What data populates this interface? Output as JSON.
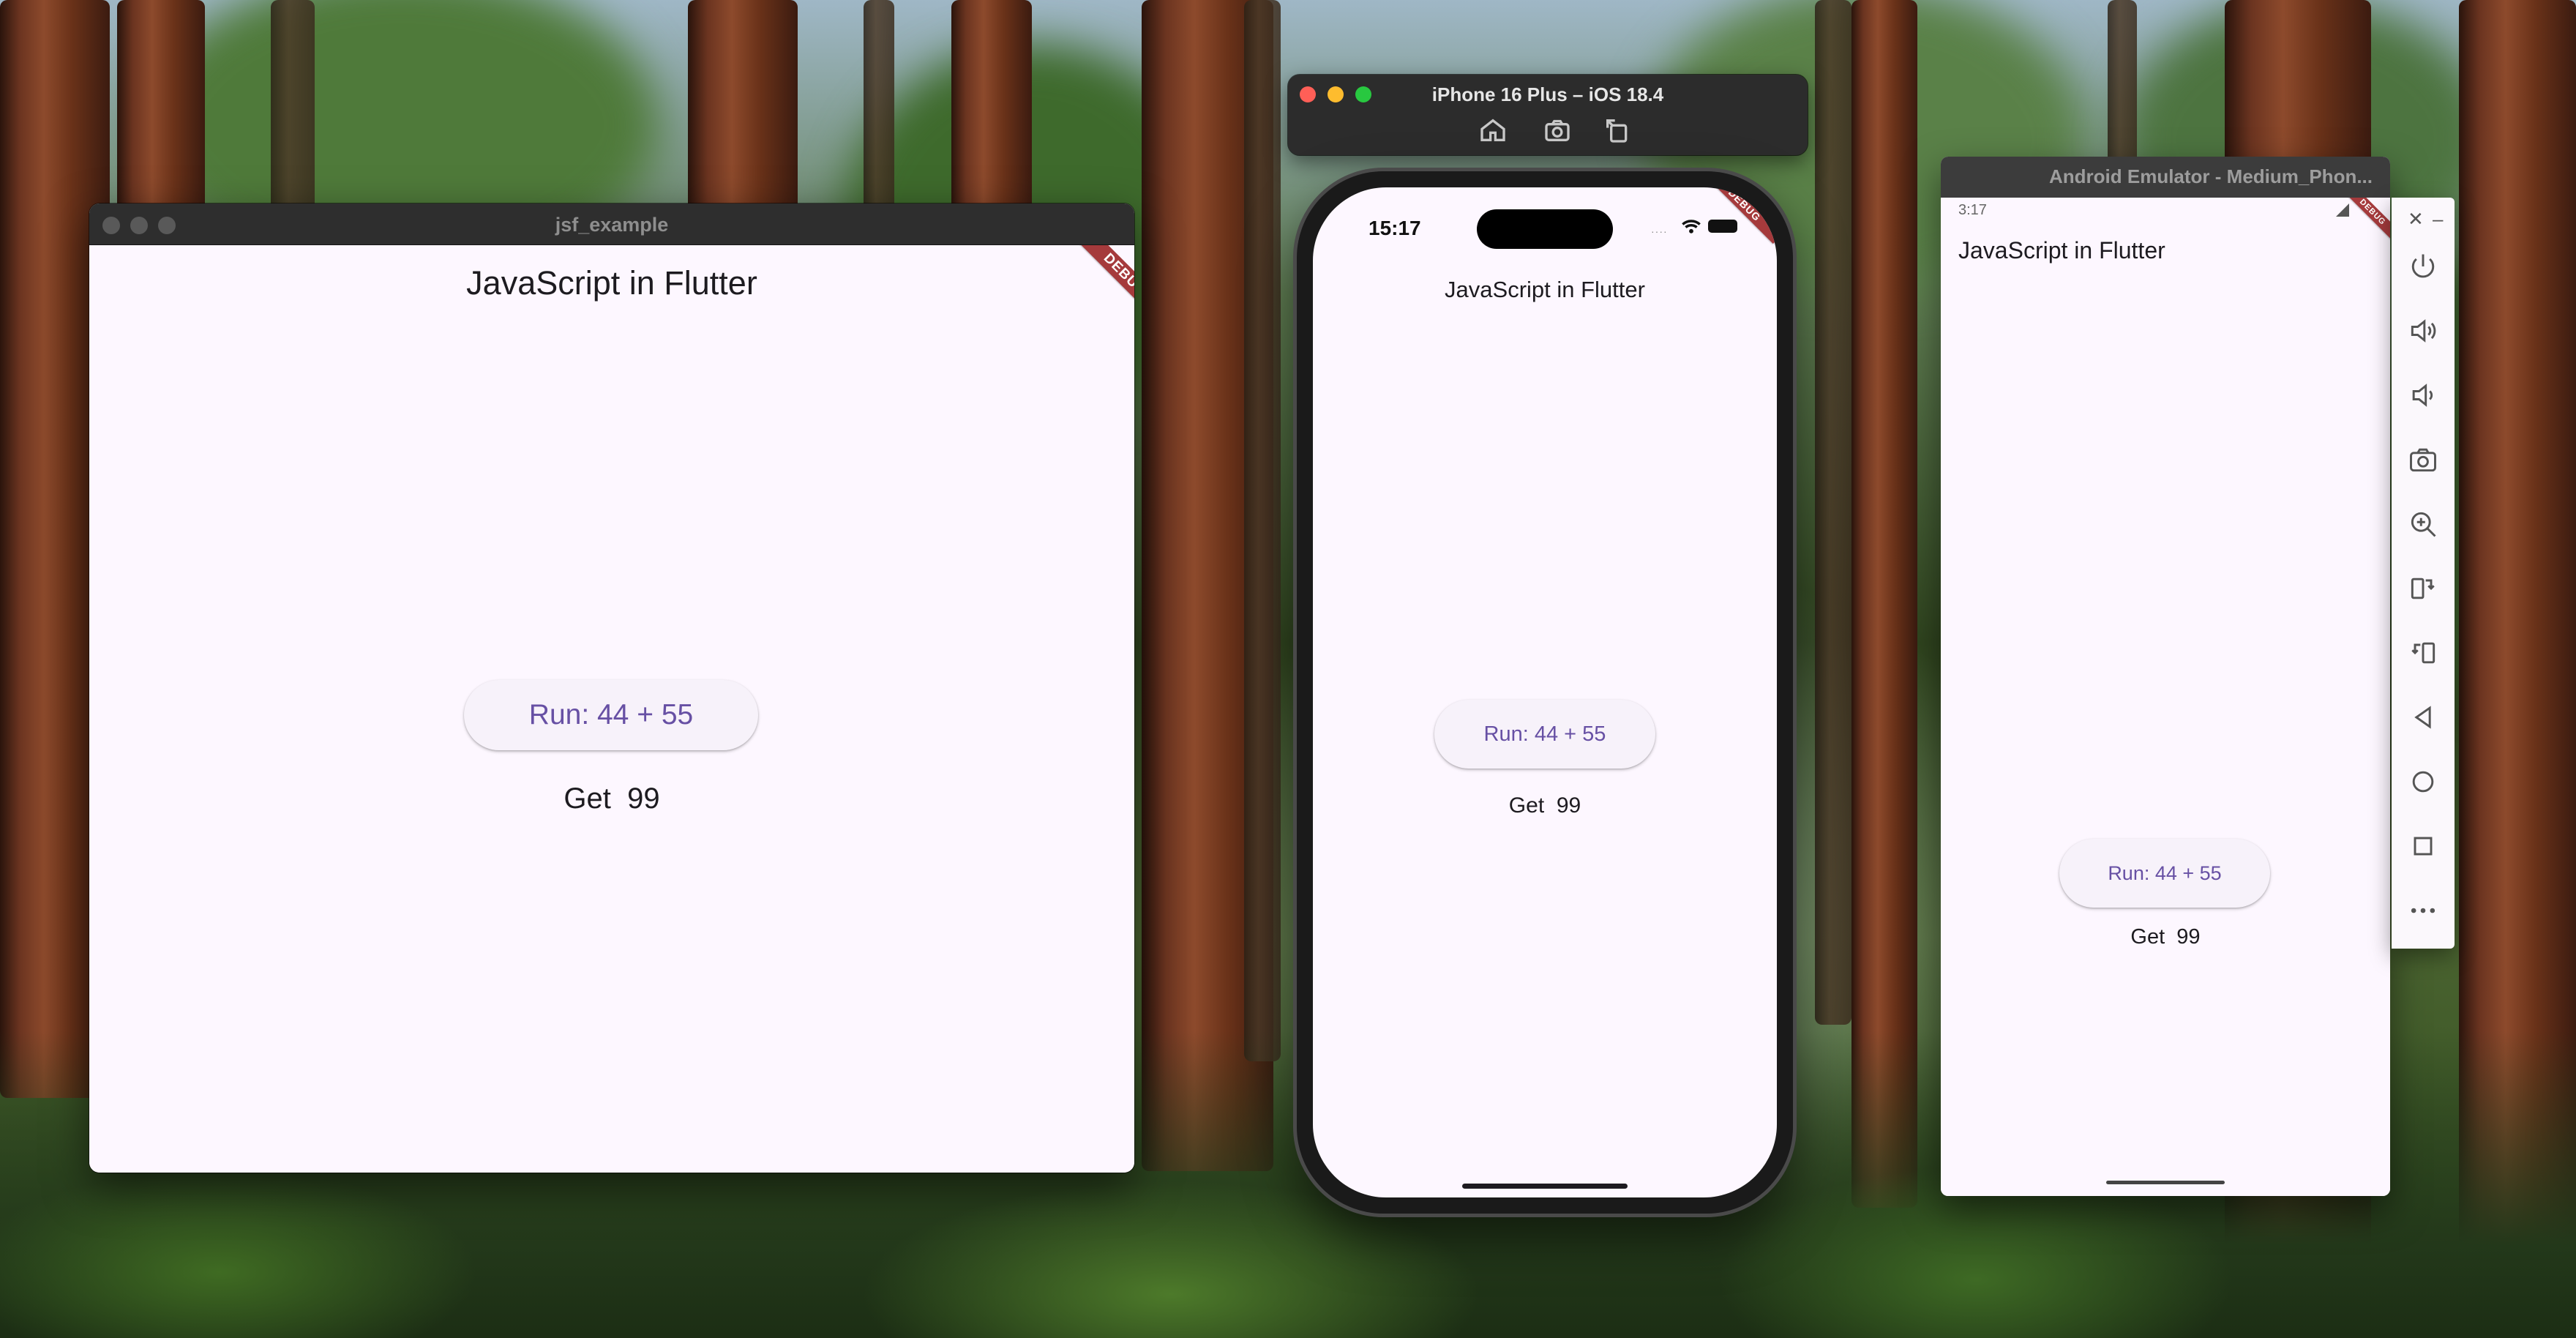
{
  "desktop": {
    "wallpaper": "forest-redwoods"
  },
  "mac_window": {
    "title": "jsf_example",
    "app_title": "JavaScript in Flutter",
    "run_button": "Run: 44 + 55",
    "result_label": "Get",
    "result_value": "99",
    "debug_banner": "DEBUG"
  },
  "ios_simulator": {
    "title": "iPhone 16 Plus – iOS 18.4",
    "status_time": "15:17",
    "toolbar_icons": [
      "home-icon",
      "screenshot-icon",
      "rotate-icon"
    ],
    "app_title": "JavaScript in Flutter",
    "run_button": "Run: 44 + 55",
    "result_label": "Get",
    "result_value": "99",
    "debug_banner": "DEBUG"
  },
  "android_emulator": {
    "title": "Android Emulator - Medium_Phon...",
    "status_time": "3:17",
    "app_title": "JavaScript in Flutter",
    "run_button": "Run: 44 + 55",
    "result_label": "Get",
    "result_value": "99",
    "debug_banner": "DEBUG",
    "sidebar_icons": [
      "power-icon",
      "volume-up-icon",
      "volume-down-icon",
      "camera-icon",
      "zoom-icon",
      "rotate-left-icon",
      "rotate-right-icon",
      "back-icon",
      "home-icon",
      "overview-icon",
      "more-icon"
    ]
  },
  "colors": {
    "app_background": "#fdf7ff",
    "button_text": "#6750a4",
    "button_background": "#f7f2fa",
    "debug_banner": "#a53a3c",
    "text": "#1d1b20"
  }
}
